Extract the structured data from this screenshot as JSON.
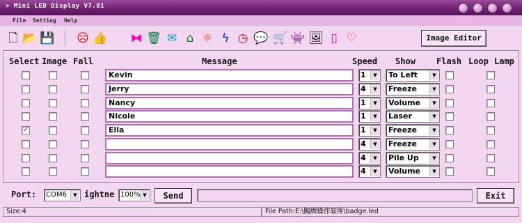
{
  "window": {
    "title": "Mini LED Display V7.01"
  },
  "menu": [
    {
      "label": "File"
    },
    {
      "label": "Setting"
    },
    {
      "label": "Help"
    }
  ],
  "toolbar": {
    "icons": [
      {
        "name": "new-file-icon",
        "glyph": "🗋",
        "color": "#000000"
      },
      {
        "name": "open-folder-icon",
        "glyph": "📂",
        "color": "#d79a00"
      },
      {
        "name": "save-icon",
        "glyph": "💾",
        "color": "#000000"
      },
      {
        "name": "smiley-icon",
        "glyph": "☹",
        "color": "#e60000"
      },
      {
        "name": "thumbs-up-icon",
        "glyph": "👍",
        "color": "#c8a000"
      },
      {
        "name": "apple-icon",
        "glyph": "",
        "color": "#2ec000"
      },
      {
        "name": "bowtie-icon",
        "glyph": "⧓",
        "color": "#ff00b4"
      },
      {
        "name": "trash-icon",
        "glyph": "🗑",
        "color": "#007e3a"
      },
      {
        "name": "envelope-icon",
        "glyph": "✉",
        "color": "#00a0d8"
      },
      {
        "name": "house-icon",
        "glyph": "⌂",
        "color": "#0a8a0a"
      },
      {
        "name": "sun-icon",
        "glyph": "☼",
        "color": "#ff3c00"
      },
      {
        "name": "lightning-icon",
        "glyph": "ϟ",
        "color": "#0022ff"
      },
      {
        "name": "clock-icon",
        "glyph": "◷",
        "color": "#e60000"
      },
      {
        "name": "speech-bubble-icon",
        "glyph": "💬",
        "color": "#8a00c8"
      },
      {
        "name": "cart-icon",
        "glyph": "🛒",
        "color": "#00a000"
      },
      {
        "name": "space-invader-icon",
        "glyph": "👾",
        "color": "#2a2aff"
      },
      {
        "name": "picture-icon",
        "glyph": "🖼",
        "color": "#000000"
      },
      {
        "name": "phone-icon",
        "glyph": "▯",
        "color": "#ff00b4"
      },
      {
        "name": "heart-icon",
        "glyph": "♡",
        "color": "#ff1e5a"
      }
    ],
    "image_editor_label": "Image Editor"
  },
  "table": {
    "headers": {
      "select": "Select",
      "image": "Image",
      "fall": "Fall",
      "message": "Message",
      "speed": "Speed",
      "show": "Show",
      "flash": "Flash",
      "loop": "Loop",
      "lamp": "Lamp"
    },
    "rows": [
      {
        "select": false,
        "image": false,
        "fall": false,
        "message": "Kevin",
        "speed": "1",
        "show": "To Left",
        "flash": false,
        "loop": false
      },
      {
        "select": false,
        "image": false,
        "fall": false,
        "message": "Jerry",
        "speed": "4",
        "show": "Freeze",
        "flash": false,
        "loop": false
      },
      {
        "select": false,
        "image": false,
        "fall": false,
        "message": "Nancy",
        "speed": "1",
        "show": "Volume",
        "flash": false,
        "loop": false
      },
      {
        "select": false,
        "image": false,
        "fall": false,
        "message": "Nicole",
        "speed": "1",
        "show": "Laser",
        "flash": false,
        "loop": false
      },
      {
        "select": true,
        "image": false,
        "fall": false,
        "message": "Ella",
        "speed": "1",
        "show": "Freeze",
        "flash": false,
        "loop": false
      },
      {
        "select": false,
        "image": false,
        "fall": false,
        "message": "",
        "speed": "4",
        "show": "Freeze",
        "flash": false,
        "loop": false
      },
      {
        "select": false,
        "image": false,
        "fall": false,
        "message": "",
        "speed": "4",
        "show": "Pile Up",
        "flash": false,
        "loop": false
      },
      {
        "select": false,
        "image": false,
        "fall": false,
        "message": "",
        "speed": "4",
        "show": "Volume",
        "flash": false,
        "loop": false
      }
    ]
  },
  "bottom": {
    "port_label": "Port:",
    "port_value": "COM6",
    "brightness_label": "ightne",
    "brightness_value": "100%",
    "send_label": "Send",
    "exit_label": "Exit"
  },
  "status": {
    "size": "Size:4",
    "path": "File Path:E:\\胸牌操作软件\\badge.led"
  }
}
